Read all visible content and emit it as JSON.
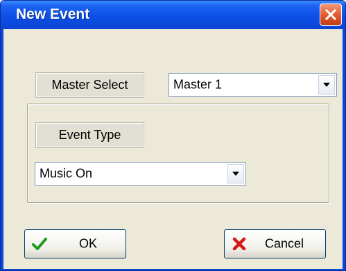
{
  "window": {
    "title": "New Event"
  },
  "master": {
    "label": "Master Select",
    "value": "Master 1"
  },
  "event": {
    "label": "Event Type",
    "value": "Music On"
  },
  "buttons": {
    "ok_label": "OK",
    "cancel_label": "Cancel"
  },
  "icons": {
    "close": "close-icon",
    "ok": "checkmark-icon",
    "cancel": "x-icon",
    "dropdown": "dropdown-arrow-icon"
  },
  "colors": {
    "titlebar": "#0d4fe6",
    "close": "#e2562c",
    "check": "#1e9a1e",
    "cross": "#d61818",
    "client": "#ece9d8"
  }
}
